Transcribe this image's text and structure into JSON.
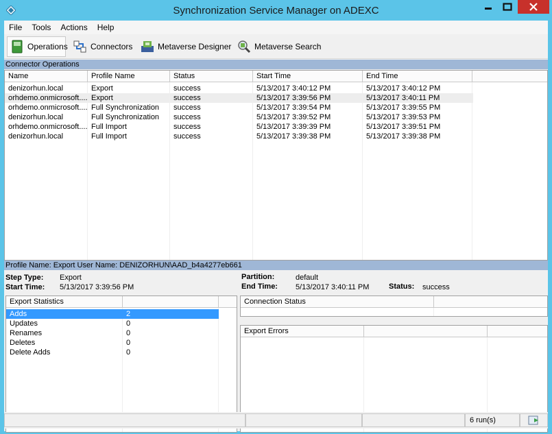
{
  "window": {
    "title": "Synchronization Service Manager on ADEXC"
  },
  "menu": [
    "File",
    "Tools",
    "Actions",
    "Help"
  ],
  "toolbar": {
    "operations": "Operations",
    "connectors": "Connectors",
    "metaverse_designer": "Metaverse Designer",
    "metaverse_search": "Metaverse Search"
  },
  "connector_operations": {
    "section_title": "Connector Operations",
    "columns": [
      "Name",
      "Profile Name",
      "Status",
      "Start Time",
      "End Time"
    ],
    "rows": [
      [
        "denizorhun.local",
        "Export",
        "success",
        "5/13/2017 3:40:12 PM",
        "5/13/2017 3:40:12 PM"
      ],
      [
        "orhdemo.onmicrosoft....",
        "Export",
        "success",
        "5/13/2017 3:39:56 PM",
        "5/13/2017 3:40:11 PM"
      ],
      [
        "orhdemo.onmicrosoft....",
        "Full Synchronization",
        "success",
        "5/13/2017 3:39:54 PM",
        "5/13/2017 3:39:55 PM"
      ],
      [
        "denizorhun.local",
        "Full Synchronization",
        "success",
        "5/13/2017 3:39:52 PM",
        "5/13/2017 3:39:53 PM"
      ],
      [
        "orhdemo.onmicrosoft....",
        "Full Import",
        "success",
        "5/13/2017 3:39:39 PM",
        "5/13/2017 3:39:51 PM"
      ],
      [
        "denizorhun.local",
        "Full Import",
        "success",
        "5/13/2017 3:39:38 PM",
        "5/13/2017 3:39:38 PM"
      ]
    ]
  },
  "details": {
    "header": "Profile Name: Export  User Name: DENIZORHUN\\AAD_b4a4277eb661",
    "step_type_label": "Step Type:",
    "step_type": "Export",
    "start_time_label": "Start Time:",
    "start_time": "5/13/2017 3:39:56 PM",
    "partition_label": "Partition:",
    "partition": "default",
    "end_time_label": "End Time:",
    "end_time": "5/13/2017 3:40:11 PM",
    "status_label": "Status:",
    "status": "success",
    "export_statistics": {
      "header": "Export Statistics",
      "rows": [
        [
          "Adds",
          "2"
        ],
        [
          "Updates",
          "0"
        ],
        [
          "Renames",
          "0"
        ],
        [
          "Deletes",
          "0"
        ],
        [
          "Delete Adds",
          "0"
        ]
      ]
    },
    "connection_status_header": "Connection Status",
    "export_errors_header": "Export Errors"
  },
  "statusbar": {
    "runs": "6 run(s)"
  },
  "colors": {
    "titlebar": "#5bc4e8",
    "section": "#9fb7d6",
    "selection": "#3399ff",
    "close": "#c7312b"
  }
}
